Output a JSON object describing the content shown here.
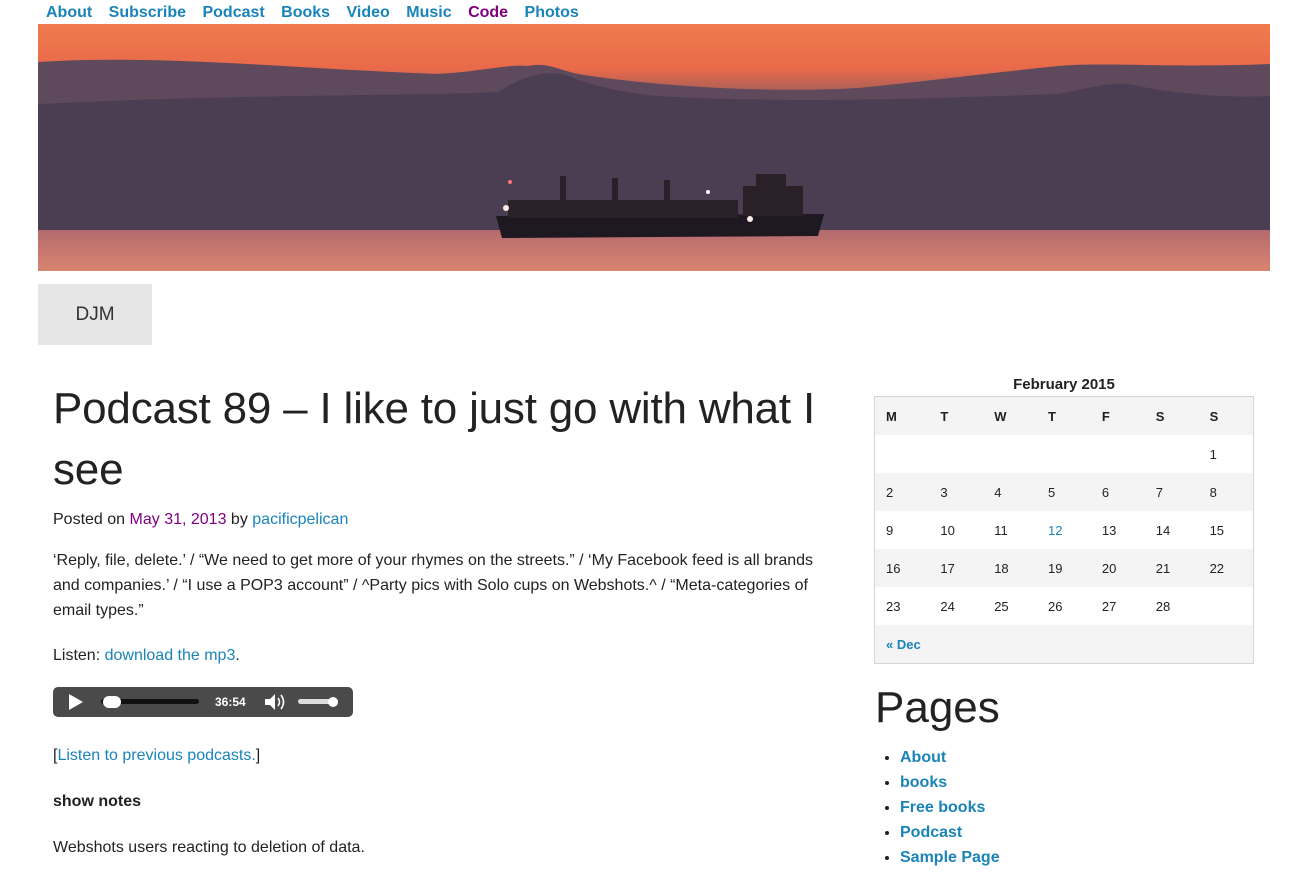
{
  "nav": {
    "items": [
      {
        "label": "About"
      },
      {
        "label": "Subscribe"
      },
      {
        "label": "Podcast"
      },
      {
        "label": "Books"
      },
      {
        "label": "Video"
      },
      {
        "label": "Music"
      },
      {
        "label": "Code"
      },
      {
        "label": "Photos"
      }
    ]
  },
  "site_title": "DJM",
  "post": {
    "title": "Podcast 89 – I like to just go with what I see",
    "posted_on_prefix": "Posted on",
    "date": "May 31, 2013",
    "by": "by",
    "author": "pacificpelican",
    "excerpt": "‘Reply, file, delete.’ / “We need to get more of your rhymes on the streets.” / ‘My Facebook feed is all brands and companies.’ / “I use a POP3 account” / ^Party pics with Solo cups on Webshots.^ / “Meta-categories of email types.”",
    "listen_prefix": "Listen:",
    "listen_link": "download the mp3",
    "listen_suffix": ".",
    "player_time": "36:54",
    "prev_open": "[",
    "prev_link": "Listen to previous podcasts.",
    "prev_close": "]",
    "shownotes_heading": "show notes",
    "notes_text": "Webshots users reacting to deletion of data."
  },
  "calendar": {
    "caption": "February 2015",
    "weekdays": [
      "M",
      "T",
      "W",
      "T",
      "F",
      "S",
      "S"
    ],
    "weeks": [
      [
        "",
        "",
        "",
        "",
        "",
        "",
        "1"
      ],
      [
        "2",
        "3",
        "4",
        "5",
        "6",
        "7",
        "8"
      ],
      [
        "9",
        "10",
        "11",
        "12",
        "13",
        "14",
        "15"
      ],
      [
        "16",
        "17",
        "18",
        "19",
        "20",
        "21",
        "22"
      ],
      [
        "23",
        "24",
        "25",
        "26",
        "27",
        "28",
        ""
      ]
    ],
    "prev_nav": "« Dec"
  },
  "pages_widget": {
    "heading": "Pages",
    "items": [
      {
        "label": "About"
      },
      {
        "label": "books"
      },
      {
        "label": "Free books"
      },
      {
        "label": "Podcast"
      },
      {
        "label": "Sample Page"
      }
    ]
  }
}
